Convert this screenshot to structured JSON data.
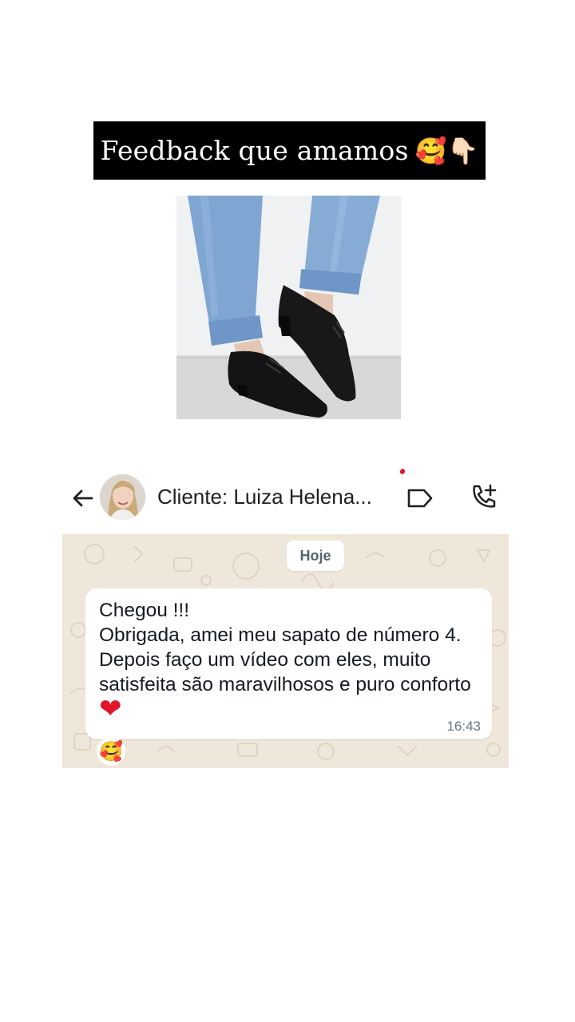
{
  "banner": {
    "title": "Feedback que amamos",
    "emojis": "🥰👇🏻"
  },
  "photo": {
    "icon": "shoes-photo"
  },
  "header": {
    "contact_name": "Cliente: Luiza Helena...",
    "icons": [
      "back-arrow-icon",
      "label-icon",
      "call-add-icon"
    ]
  },
  "chat": {
    "date_chip": "Hoje",
    "message": {
      "text": "Chegou !!!\nObrigada, amei meu sapato de número 4. Depois faço um vídeo com eles, muito satisfeita são maravilhosos e puro conforto ",
      "emoji": "❤",
      "time": "16:43"
    },
    "reaction": "🥰"
  },
  "colors": {
    "banner_bg": "#000000",
    "chat_wallpaper": "#efe7da",
    "bubble_bg": "#ffffff",
    "heart": "#e0162b"
  }
}
